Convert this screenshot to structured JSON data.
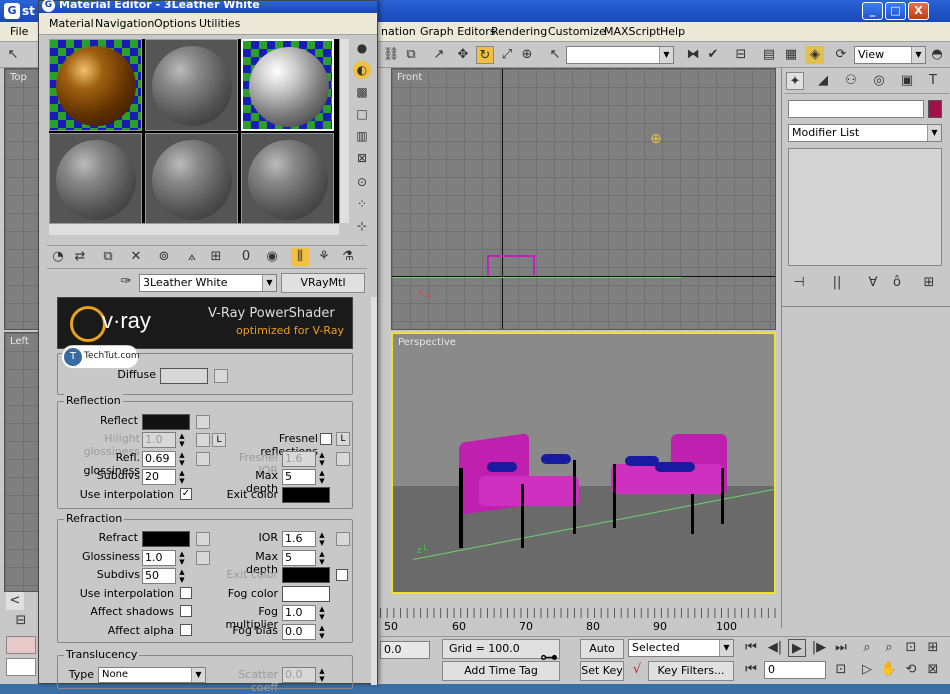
{
  "app": {
    "title_fragment": "st",
    "window_controls": [
      "_",
      "□",
      "X"
    ]
  },
  "main_menu": {
    "file": "File",
    "animation": "nation",
    "graph_editors": "Graph Editors",
    "rendering": "Rendering",
    "customize": "Customize",
    "maxscript": "MAXScript",
    "help": "Help"
  },
  "toolbar": {
    "view_dropdown": "View"
  },
  "viewports": {
    "top_label": "Top",
    "left_label": "Left",
    "front_label": "Front",
    "perspective_label": "Perspective"
  },
  "command_panel": {
    "modifier_list": "Modifier List",
    "name_field": "",
    "object_color": "#a0104a"
  },
  "timeline": {
    "ticks": [
      "50",
      "60",
      "70",
      "80",
      "90",
      "100"
    ]
  },
  "bottom": {
    "coord_field": "0.0",
    "grid": "Grid = 100.0",
    "add_time_tag": "Add Time Tag",
    "auto_key": "Auto Key",
    "set_key": "Set Key",
    "selected": "Selected",
    "key_filters": "Key Filters...",
    "frame_field": "0"
  },
  "material_editor": {
    "title": "Material Editor - 3Leather White",
    "menu": {
      "material": "Material",
      "navigation": "Navigation",
      "options": "Options",
      "utilities": "Utilities"
    },
    "material_name": "3Leather White",
    "material_type": "VRayMtl",
    "banner": {
      "logo": "v·ray",
      "title": "V-Ray PowerShader",
      "subtitle": "optimized for V-Ray"
    },
    "watermark": "TechTut.com",
    "diffuse_label": "Diffuse",
    "reflection": {
      "title": "Reflection",
      "reflect_label": "Reflect",
      "hilight_label": "Hilight glossiness",
      "hilight_value": "1.0",
      "refl_gloss_label": "Refl. glossiness",
      "refl_gloss_value": "0.69",
      "subdivs_label": "Subdivs",
      "subdivs_value": "20",
      "use_interp_label": "Use interpolation",
      "use_interp_checked": "✓",
      "fresnel_label": "Fresnel reflections",
      "fresnel_ior_label": "Fresnel IOR",
      "fresnel_ior_value": "1.6",
      "max_depth_label": "Max depth",
      "max_depth_value": "5",
      "exit_color_label": "Exit color",
      "l_button": "L"
    },
    "refraction": {
      "title": "Refraction",
      "refract_label": "Refract",
      "glossiness_label": "Glossiness",
      "glossiness_value": "1.0",
      "subdivs_label": "Subdivs",
      "subdivs_value": "50",
      "use_interp_label": "Use interpolation",
      "affect_shadows_label": "Affect shadows",
      "affect_alpha_label": "Affect alpha",
      "ior_label": "IOR",
      "ior_value": "1.6",
      "max_depth_label": "Max depth",
      "max_depth_value": "5",
      "exit_color_label": "Exit color",
      "fog_color_label": "Fog color",
      "fog_mult_label": "Fog multiplier",
      "fog_mult_value": "1.0",
      "fog_bias_label": "Fog bias",
      "fog_bias_value": "0.0"
    },
    "translucency": {
      "title": "Translucency",
      "type_label": "Type",
      "type_value": "None",
      "scatter_label": "Scatter coeff",
      "scatter_value": "0.0"
    }
  }
}
